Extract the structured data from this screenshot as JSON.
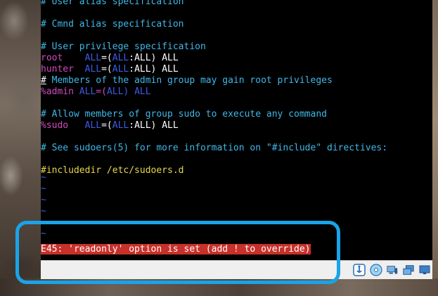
{
  "terminal": {
    "lines": {
      "l0": "# User alias specification",
      "l1": "# Cmnd alias specification",
      "l2": "# User privilege specification",
      "root_user": "root",
      "hunter_user": "hunter",
      "all_a": "ALL",
      "all_eq": "=(",
      "all_b": "ALL",
      "all_rest": ":ALL) ALL",
      "comment_hash": "#",
      "comment_admin": " Members of the admin group may gain root privileges",
      "admin_line_a": "%admin",
      "admin_line_b": "ALL",
      "admin_line_c": "=(",
      "admin_line_d": "ALL",
      "admin_line_e": ") ALL",
      "l7": "# Allow members of group sudo to execute any command",
      "sudo_user": "%sudo",
      "l9": "# See sudoers(5) for more information on \"#include\" directives:",
      "l10": "#includedir /etc/sudoers.d",
      "tilde": "~"
    },
    "error": "E45: 'readonly' option is set (add ! to override)"
  },
  "statusbar": {
    "icons": [
      "usb-icon",
      "optical-disc-icon",
      "network-icon",
      "shared-folder-icon",
      "display-icon"
    ]
  },
  "colors": {
    "error_bg": "#c8302a",
    "highlight": "#1aa3e8",
    "comment": "#3fb8e8",
    "user": "#d04bc0",
    "keyword": "#3d5be8",
    "directive": "#e8d84a"
  }
}
